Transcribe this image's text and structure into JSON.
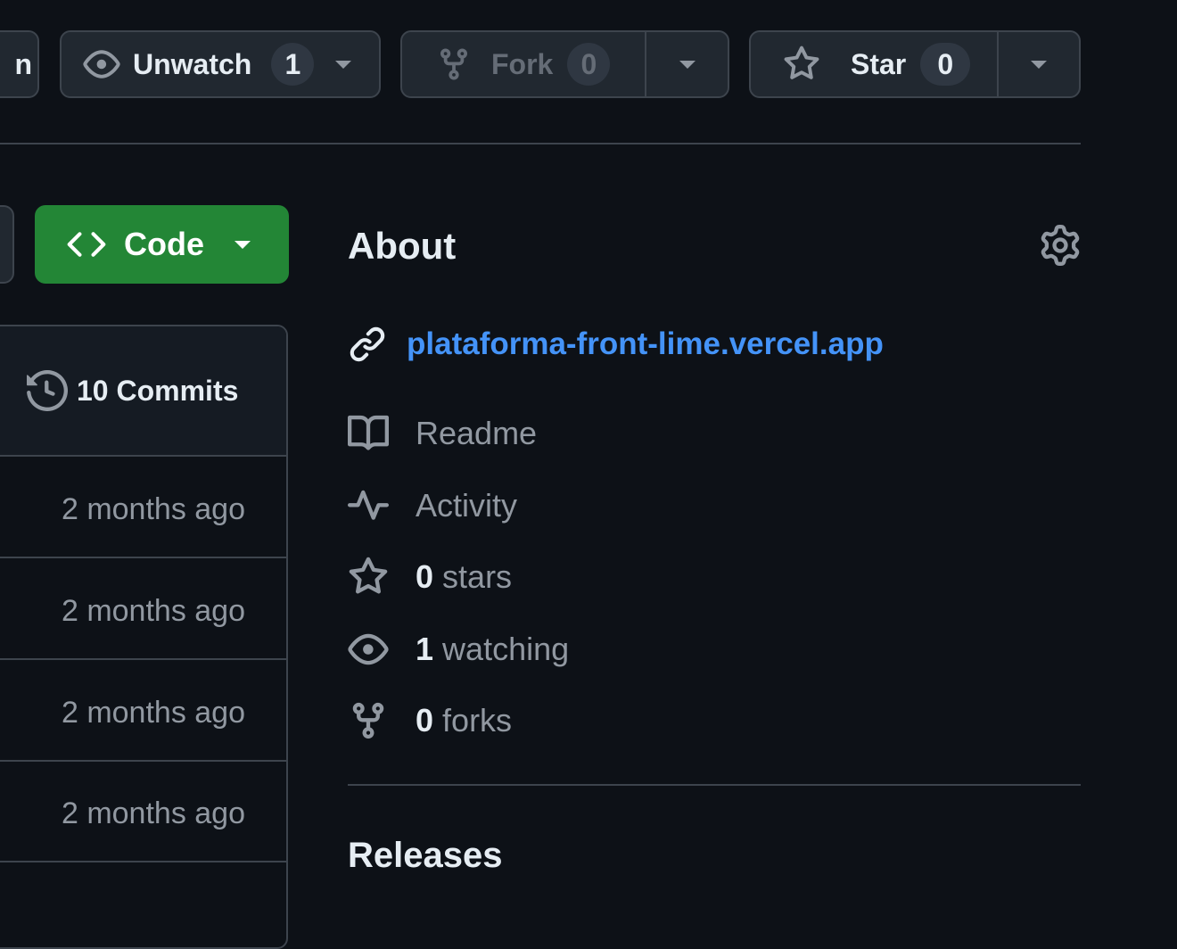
{
  "header": {
    "cut_button_fragment": "n",
    "unwatch": {
      "label": "Unwatch",
      "count": "1"
    },
    "fork": {
      "label": "Fork",
      "count": "0"
    },
    "star": {
      "label": "Star",
      "count": "0"
    }
  },
  "code_button": {
    "label": "Code"
  },
  "commits": {
    "label": "10 Commits"
  },
  "file_rows": [
    {
      "time": "2 months ago"
    },
    {
      "time": "2 months ago"
    },
    {
      "time": "2 months ago"
    },
    {
      "time": "2 months ago"
    }
  ],
  "about": {
    "title": "About",
    "website": "plataforma-front-lime.vercel.app",
    "readme": "Readme",
    "activity": "Activity",
    "stars_count": "0",
    "stars_label": "stars",
    "watching_count": "1",
    "watching_label": "watching",
    "forks_count": "0",
    "forks_label": "forks"
  },
  "releases": {
    "title": "Releases"
  },
  "icons": [
    "eye-icon",
    "repo-forked-icon",
    "star-icon",
    "code-icon",
    "history-icon",
    "gear-icon",
    "link-icon",
    "book-icon",
    "pulse-icon"
  ],
  "colors": {
    "background": "#0d1117",
    "code_button": "#238636",
    "link": "#4493f8",
    "muted": "#9198a1",
    "border": "#3d444d"
  }
}
